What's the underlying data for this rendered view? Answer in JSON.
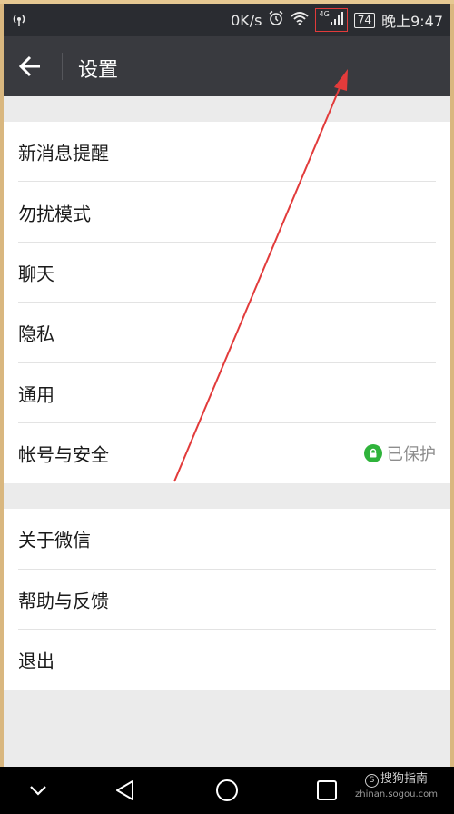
{
  "status_bar": {
    "left_icon": "hotspot-icon",
    "speed": "0K/s",
    "alarm_icon": "alarm-icon",
    "wifi_icon": "wifi-icon",
    "network_type": "4G",
    "signal_icon": "cell-signal-icon",
    "battery": "74",
    "time": "晚上9:47"
  },
  "app_bar": {
    "title": "设置",
    "back_icon": "back-arrow-icon"
  },
  "settings": {
    "group1": [
      {
        "label": "新消息提醒"
      },
      {
        "label": "勿扰模式"
      },
      {
        "label": "聊天"
      },
      {
        "label": "隐私"
      },
      {
        "label": "通用"
      },
      {
        "label": "帐号与安全",
        "status": "已保护",
        "status_icon": "lock-icon"
      }
    ],
    "group2": [
      {
        "label": "关于微信"
      },
      {
        "label": "帮助与反馈"
      },
      {
        "label": "退出"
      }
    ]
  },
  "nav_bar": {
    "icons": [
      "chevron-down-icon",
      "back-triangle-icon",
      "home-circle-icon",
      "recents-square-icon"
    ],
    "watermark": "搜狗指南",
    "watermark_url": "zhinan.sogou.com"
  },
  "colors": {
    "status_bar_bg": "#2a2c31",
    "app_bar_bg": "#393a3f",
    "page_bg": "#ebebeb",
    "protected_green": "#2fb33b",
    "annotation_red": "#e23b3b"
  }
}
